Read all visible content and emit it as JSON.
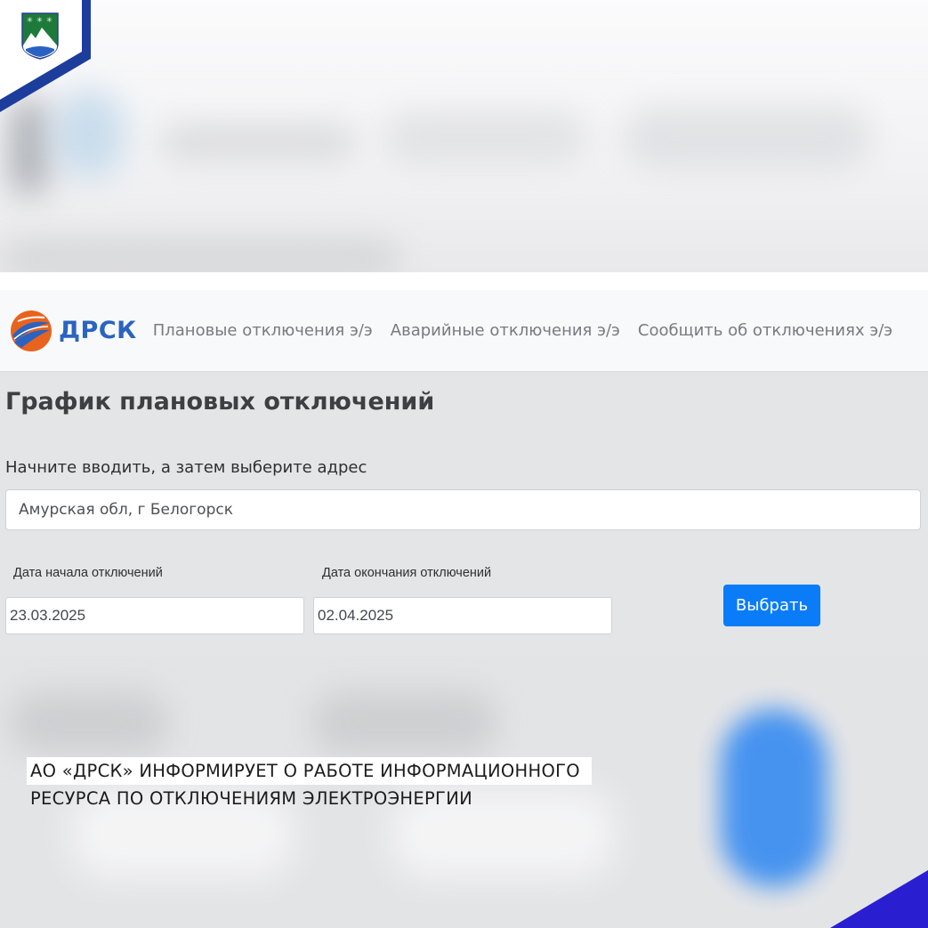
{
  "brand": {
    "name": "ДРСК",
    "color": "#2b63c0"
  },
  "nav": {
    "items": [
      "Плановые отключения э/э",
      "Аварийные отключения э/э",
      "Сообщить об отключениях э/э"
    ]
  },
  "main": {
    "title": "График плановых отключений",
    "address_label": "Начните вводить, а затем выберите адрес",
    "address_value": "Амурская обл, г Белогорск",
    "start_label": "Дата начала отключений",
    "start_value": "23.03.2025",
    "end_label": "Дата окончания отключений",
    "end_value": "02.04.2025",
    "submit_label": "Выбрать",
    "submit_color": "#0b7cf8"
  },
  "caption": {
    "line1": "АО «ДРСК» ИНФОРМИРУЕТ О РАБОТЕ ИНФОРМАЦИОННОГО",
    "line2": "РЕСУРСА ПО ОТКЛЮЧЕНИЯМ ЭЛЕКТРОЭНЕРГИИ"
  },
  "icons": {
    "coat_of_arms": "coat-of-arms-icon",
    "brand_logo": "drsk-globe-logo-icon"
  },
  "colors": {
    "frame_blue": "#1d3d9c",
    "corner_blue": "#2a1fd0"
  }
}
